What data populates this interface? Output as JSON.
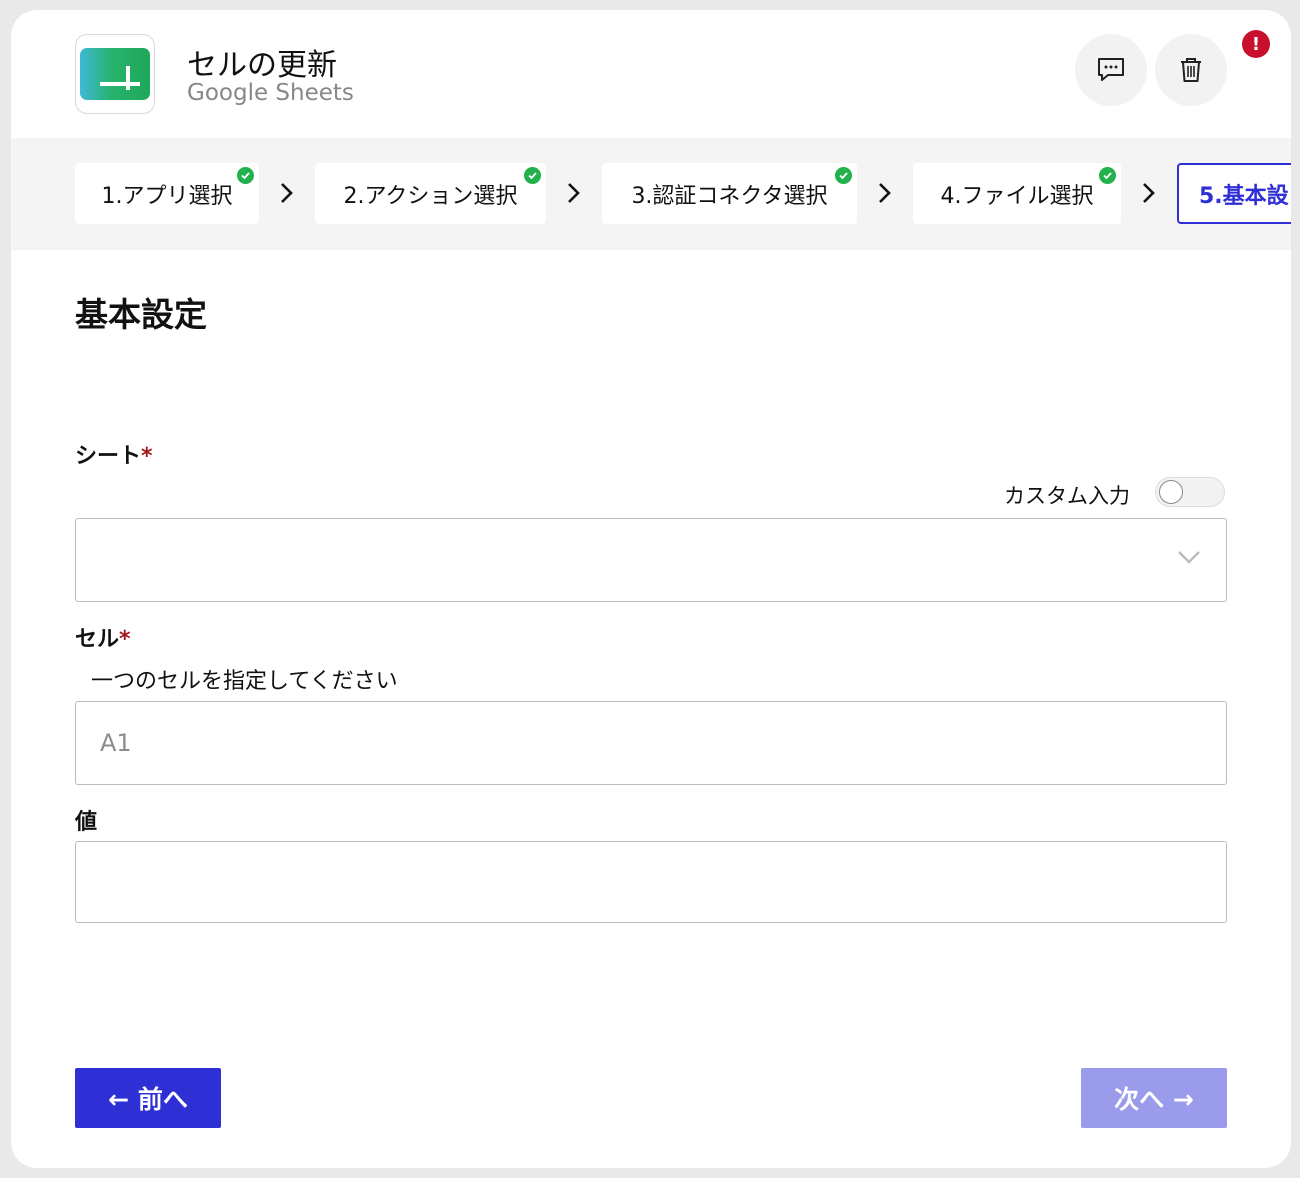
{
  "header": {
    "title": "セルの更新",
    "subtitle": "Google Sheets",
    "alert_badge": "!"
  },
  "steps": [
    {
      "label": "1.アプリ選択",
      "done": true
    },
    {
      "label": "2.アクション選択",
      "done": true
    },
    {
      "label": "3.認証コネクタ選択",
      "done": true
    },
    {
      "label": "4.ファイル選択",
      "done": true
    },
    {
      "label": "5.基本設",
      "done": false,
      "active": true
    }
  ],
  "section_title": "基本設定",
  "form": {
    "sheet": {
      "label": "シート",
      "required_mark": "*",
      "custom_input_label": "カスタム入力",
      "custom_input_on": false,
      "selected_value": ""
    },
    "cell": {
      "label": "セル",
      "required_mark": "*",
      "hint": "一つのセルを指定してください",
      "placeholder": "A1",
      "value": ""
    },
    "value": {
      "label": "値",
      "value": ""
    }
  },
  "buttons": {
    "prev": "← 前へ",
    "next": "次へ →"
  },
  "colors": {
    "primary": "#2f2fd6",
    "primary_disabled": "#9b9bec",
    "success": "#22b14c",
    "alert": "#c8102e",
    "required": "#a4141c"
  }
}
